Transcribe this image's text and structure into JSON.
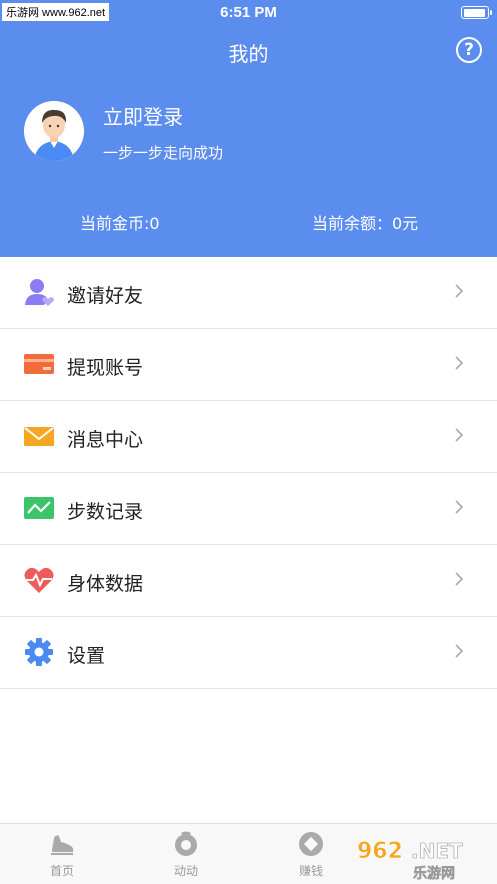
{
  "status_bar": {
    "watermark": "乐游网 www.962.net",
    "time": "6:51 PM"
  },
  "header": {
    "title": "我的",
    "help_icon": "help-circle-icon"
  },
  "profile": {
    "login": "立即登录",
    "slogan": "一步一步走向成功"
  },
  "stats": {
    "coins": "当前金币:0",
    "balance": "当前余额：0元"
  },
  "menu": [
    {
      "label": "邀请好友",
      "icon": "invite-friend-icon",
      "color": "#8b7cf6"
    },
    {
      "label": "提现账号",
      "icon": "card-icon",
      "color": "#f26b3a"
    },
    {
      "label": "消息中心",
      "icon": "mail-icon",
      "color": "#f5a623"
    },
    {
      "label": "步数记录",
      "icon": "chart-icon",
      "color": "#3ac569"
    },
    {
      "label": "身体数据",
      "icon": "heart-pulse-icon",
      "color": "#f05b5b"
    },
    {
      "label": "设置",
      "icon": "gear-icon",
      "color": "#4a8af4"
    }
  ],
  "tabbar": [
    {
      "label": "首页",
      "icon": "shoe-icon"
    },
    {
      "label": "动动",
      "icon": "activity-icon"
    },
    {
      "label": "赚钱",
      "icon": "coin-icon"
    }
  ],
  "watermark_logo": "962.NET 乐游网",
  "colors": {
    "header_bg": "#5b8def"
  }
}
